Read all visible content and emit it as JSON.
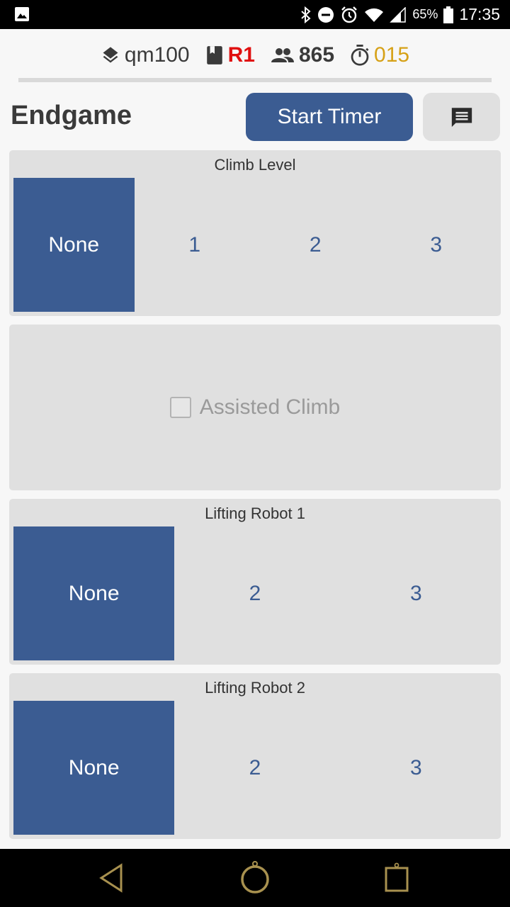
{
  "status_bar": {
    "battery": "65%",
    "time": "17:35"
  },
  "info": {
    "match": "qm100",
    "alliance": "R1",
    "team": "865",
    "timer": "015"
  },
  "colors": {
    "primary": "#3b5c92",
    "alliance_red": "#e01010",
    "timer_gold": "#d6a117",
    "panel_bg": "#e0e0e0"
  },
  "page": {
    "title": "Endgame",
    "start_timer_label": "Start Timer"
  },
  "climb": {
    "label": "Climb Level",
    "options": [
      "None",
      "1",
      "2",
      "3"
    ],
    "selected": "None"
  },
  "assisted": {
    "label": "Assisted Climb",
    "checked": false
  },
  "lifting1": {
    "label": "Lifting Robot 1",
    "options": [
      "None",
      "2",
      "3"
    ],
    "selected": "None"
  },
  "lifting2": {
    "label": "Lifting Robot 2",
    "options": [
      "None",
      "2",
      "3"
    ],
    "selected": "None"
  },
  "icons": {
    "match": "layers-icon",
    "alliance": "book-icon",
    "team": "group-icon",
    "timer": "stopwatch-icon",
    "comment": "comment-icon",
    "nav_back": "back-triangle-icon",
    "nav_home": "home-circle-icon",
    "nav_recents": "recents-square-icon"
  }
}
